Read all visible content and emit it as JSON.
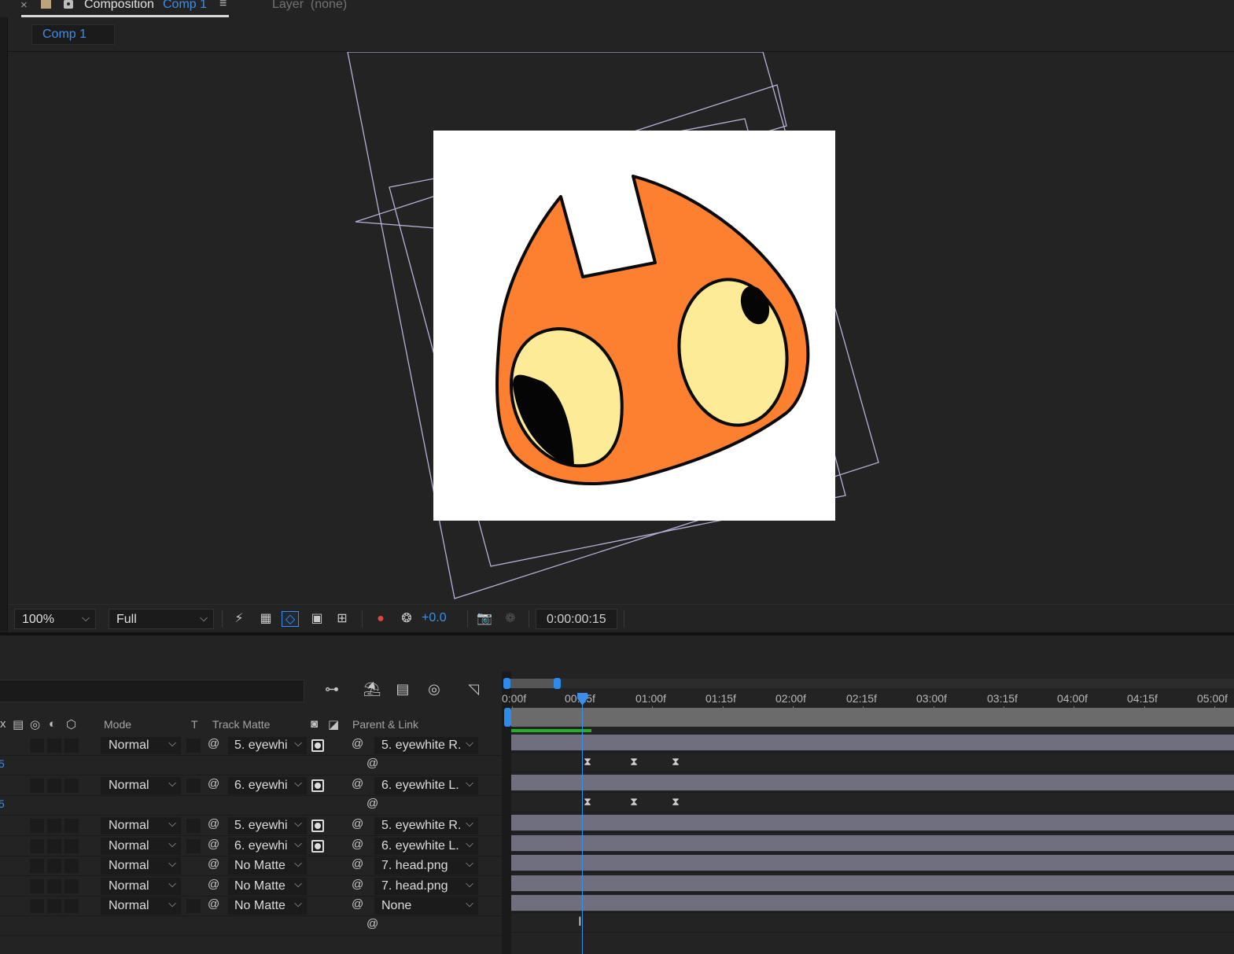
{
  "tabs": {
    "close": "×",
    "composition_label": "Composition",
    "comp_name": "Comp 1",
    "menu": "≡",
    "layer_label": "Layer",
    "layer_value": "(none)"
  },
  "breadcrumb": {
    "comp": "Comp 1"
  },
  "viewer_toolbar": {
    "zoom": "100%",
    "resolution": "Full",
    "exposure": "+0.0",
    "timecode": "0:00:00:15"
  },
  "timeline": {
    "columns": {
      "mode": "Mode",
      "t": "T",
      "track_matte": "Track Matte",
      "parent_link": "Parent & Link"
    },
    "ruler": [
      "0:00f",
      "00:15f",
      "01:00f",
      "01:15f",
      "02:00f",
      "02:15f",
      "03:00f",
      "03:15f",
      "04:00f",
      "04:15f",
      "05:00f"
    ],
    "layers": [
      {
        "mode": "Normal",
        "matte": "5. eyewhi",
        "parent": "5. eyewhite R."
      },
      {
        "sub": "5"
      },
      {
        "mode": "Normal",
        "matte": "6. eyewhi",
        "parent": "6. eyewhite L."
      },
      {
        "sub": "5"
      },
      {
        "mode": "Normal",
        "matte": "5. eyewhi",
        "parent": "5. eyewhite R."
      },
      {
        "mode": "Normal",
        "matte": "6. eyewhi",
        "parent": "6. eyewhite L."
      },
      {
        "mode": "Normal",
        "matte": "No Matte",
        "parent": "7. head.png"
      },
      {
        "mode": "Normal",
        "matte": "No Matte",
        "parent": "7. head.png"
      },
      {
        "mode": "Normal",
        "matte": "No Matte",
        "parent": "None"
      }
    ]
  },
  "colors": {
    "accent": "#3d8ee6",
    "cat_orange": "#fd8030",
    "eye_white": "#fdeb97",
    "track_bar": "#6f6f7f",
    "cache": "#22b02a"
  }
}
